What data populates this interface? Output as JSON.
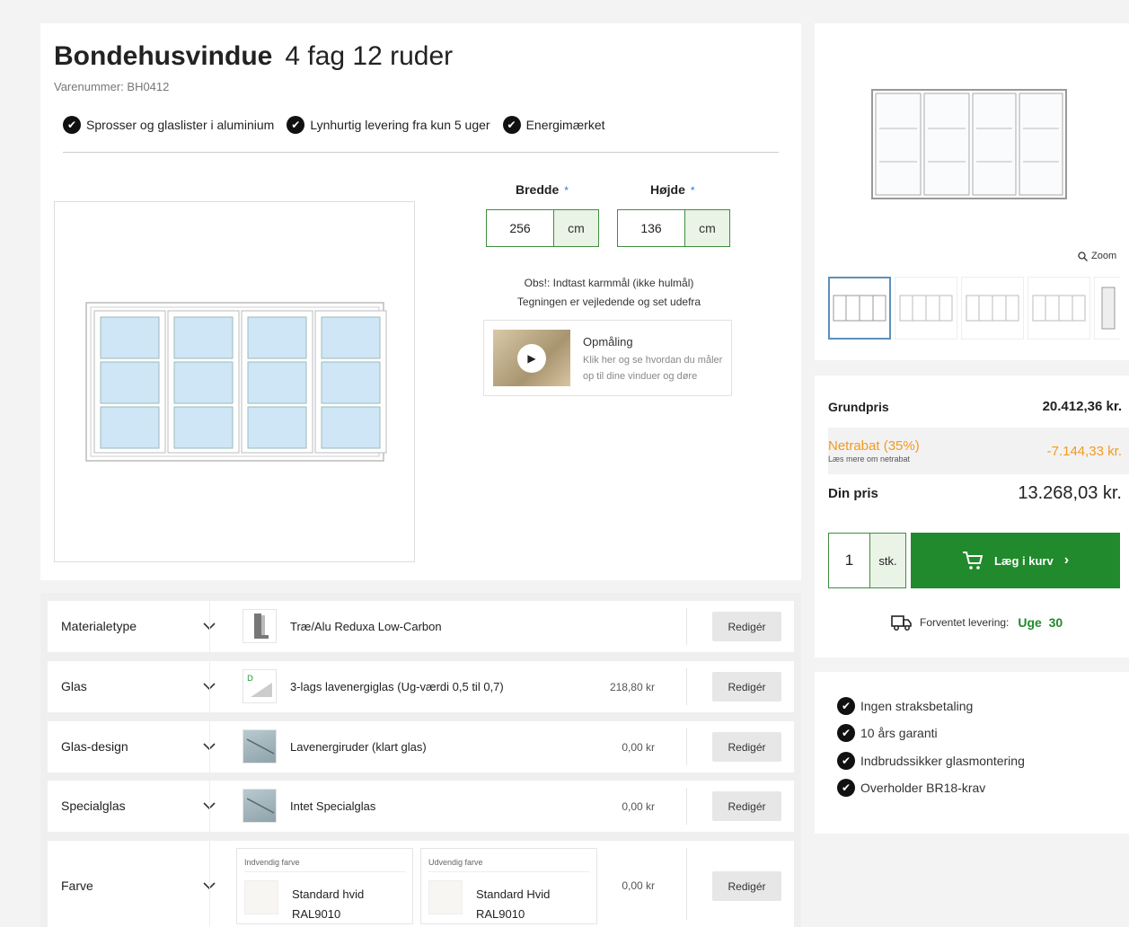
{
  "product": {
    "name_bold": "Bondehusvindue",
    "name_rest": "4 fag 12 ruder",
    "sku": "Varenummer: BH0412",
    "features": [
      "Sprosser og glaslister i aluminium",
      "Lynhurtig levering fra kun 5 uger",
      "Energimærket"
    ]
  },
  "dimensions": {
    "width_label": "Bredde",
    "width_value": "256",
    "height_label": "Højde",
    "height_value": "136",
    "unit": "cm",
    "required_mark": "*",
    "note_1": "Obs!: Indtast karmmål (ikke hulmål)",
    "note_2": "Tegningen er vejledende og set udefra"
  },
  "video": {
    "title": "Opmåling",
    "desc": "Klik her og se hvordan du måler op til dine vinduer og døre"
  },
  "gallery": {
    "zoom_label": "Zoom"
  },
  "price": {
    "base_label": "Grundpris",
    "base_value": "20.412,36 kr.",
    "discount_label": "Netrabat (35%)",
    "discount_link": "Læs mere om netrabat",
    "discount_value": "-7.144,33 kr.",
    "your_label": "Din pris",
    "your_value": "13.268,03 kr.",
    "qty": "1",
    "qty_unit": "stk.",
    "cart_label": "Læg i kurv",
    "delivery_label": "Forventet levering:",
    "delivery_week_label": "Uge",
    "delivery_week": "30"
  },
  "usps": [
    "Ingen straksbetaling",
    "10 års garanti",
    "Indbrudssikker glasmontering",
    "Overholder BR18-krav"
  ],
  "options": [
    {
      "name": "Materialetype",
      "desc": "Træ/Alu Reduxa Low-Carbon",
      "price": "",
      "edit": "Redigér"
    },
    {
      "name": "Glas",
      "desc": "3-lags lavenergiglas (Ug-værdi 0,5 til 0,7)",
      "price": "218,80 kr",
      "edit": "Redigér"
    },
    {
      "name": "Glas-design",
      "desc": "Lavenergiruder (klart glas)",
      "price": "0,00 kr",
      "edit": "Redigér"
    },
    {
      "name": "Specialglas",
      "desc": "Intet Specialglas",
      "price": "0,00 kr",
      "edit": "Redigér"
    },
    {
      "name": "Farve",
      "price": "0,00 kr",
      "edit": "Redigér",
      "inside_label": "Indvendig farve",
      "inside_name": "Standard hvid",
      "inside_ral": "RAL9010",
      "outside_label": "Udvendig farve",
      "outside_name": "Standard Hvid",
      "outside_ral": "RAL9010"
    }
  ],
  "colors": {
    "accent_green": "#218a2c",
    "discount_orange": "#f39a1e",
    "glass_blue": "#cfe6f7"
  }
}
